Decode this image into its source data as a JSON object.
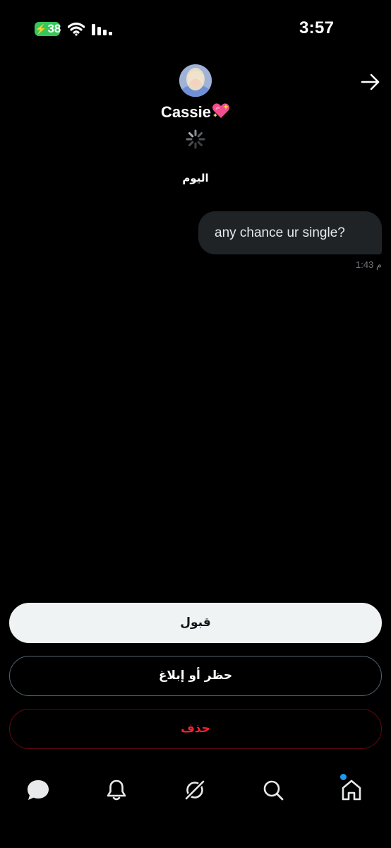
{
  "status_bar": {
    "battery_level": "38",
    "time": "3:57",
    "battery_color": "#34c759",
    "icons": [
      "battery-charging-icon",
      "wifi-icon",
      "cellular-signal-icon"
    ]
  },
  "header": {
    "contact_name": "Cassie",
    "name_emoji_icon": "sparkling-heart-icon",
    "avatar_icon": "avatar",
    "forward_icon": "arrow-right-icon",
    "loading_icon": "spinner-icon"
  },
  "conversation": {
    "day_label": "اليوم",
    "messages": [
      {
        "text": "any chance ur single?",
        "time": "1:43 م",
        "direction": "outgoing"
      }
    ]
  },
  "actions": {
    "accept_label": "قبول",
    "block_report_label": "حظر أو إبلاغ",
    "delete_label": "حذف",
    "delete_color": "#f4212e"
  },
  "bottom_nav": {
    "items": [
      "messages-icon",
      "notifications-bell-icon",
      "grok-icon",
      "search-icon",
      "home-icon"
    ],
    "notification_dot_color": "#1d9bf0"
  }
}
